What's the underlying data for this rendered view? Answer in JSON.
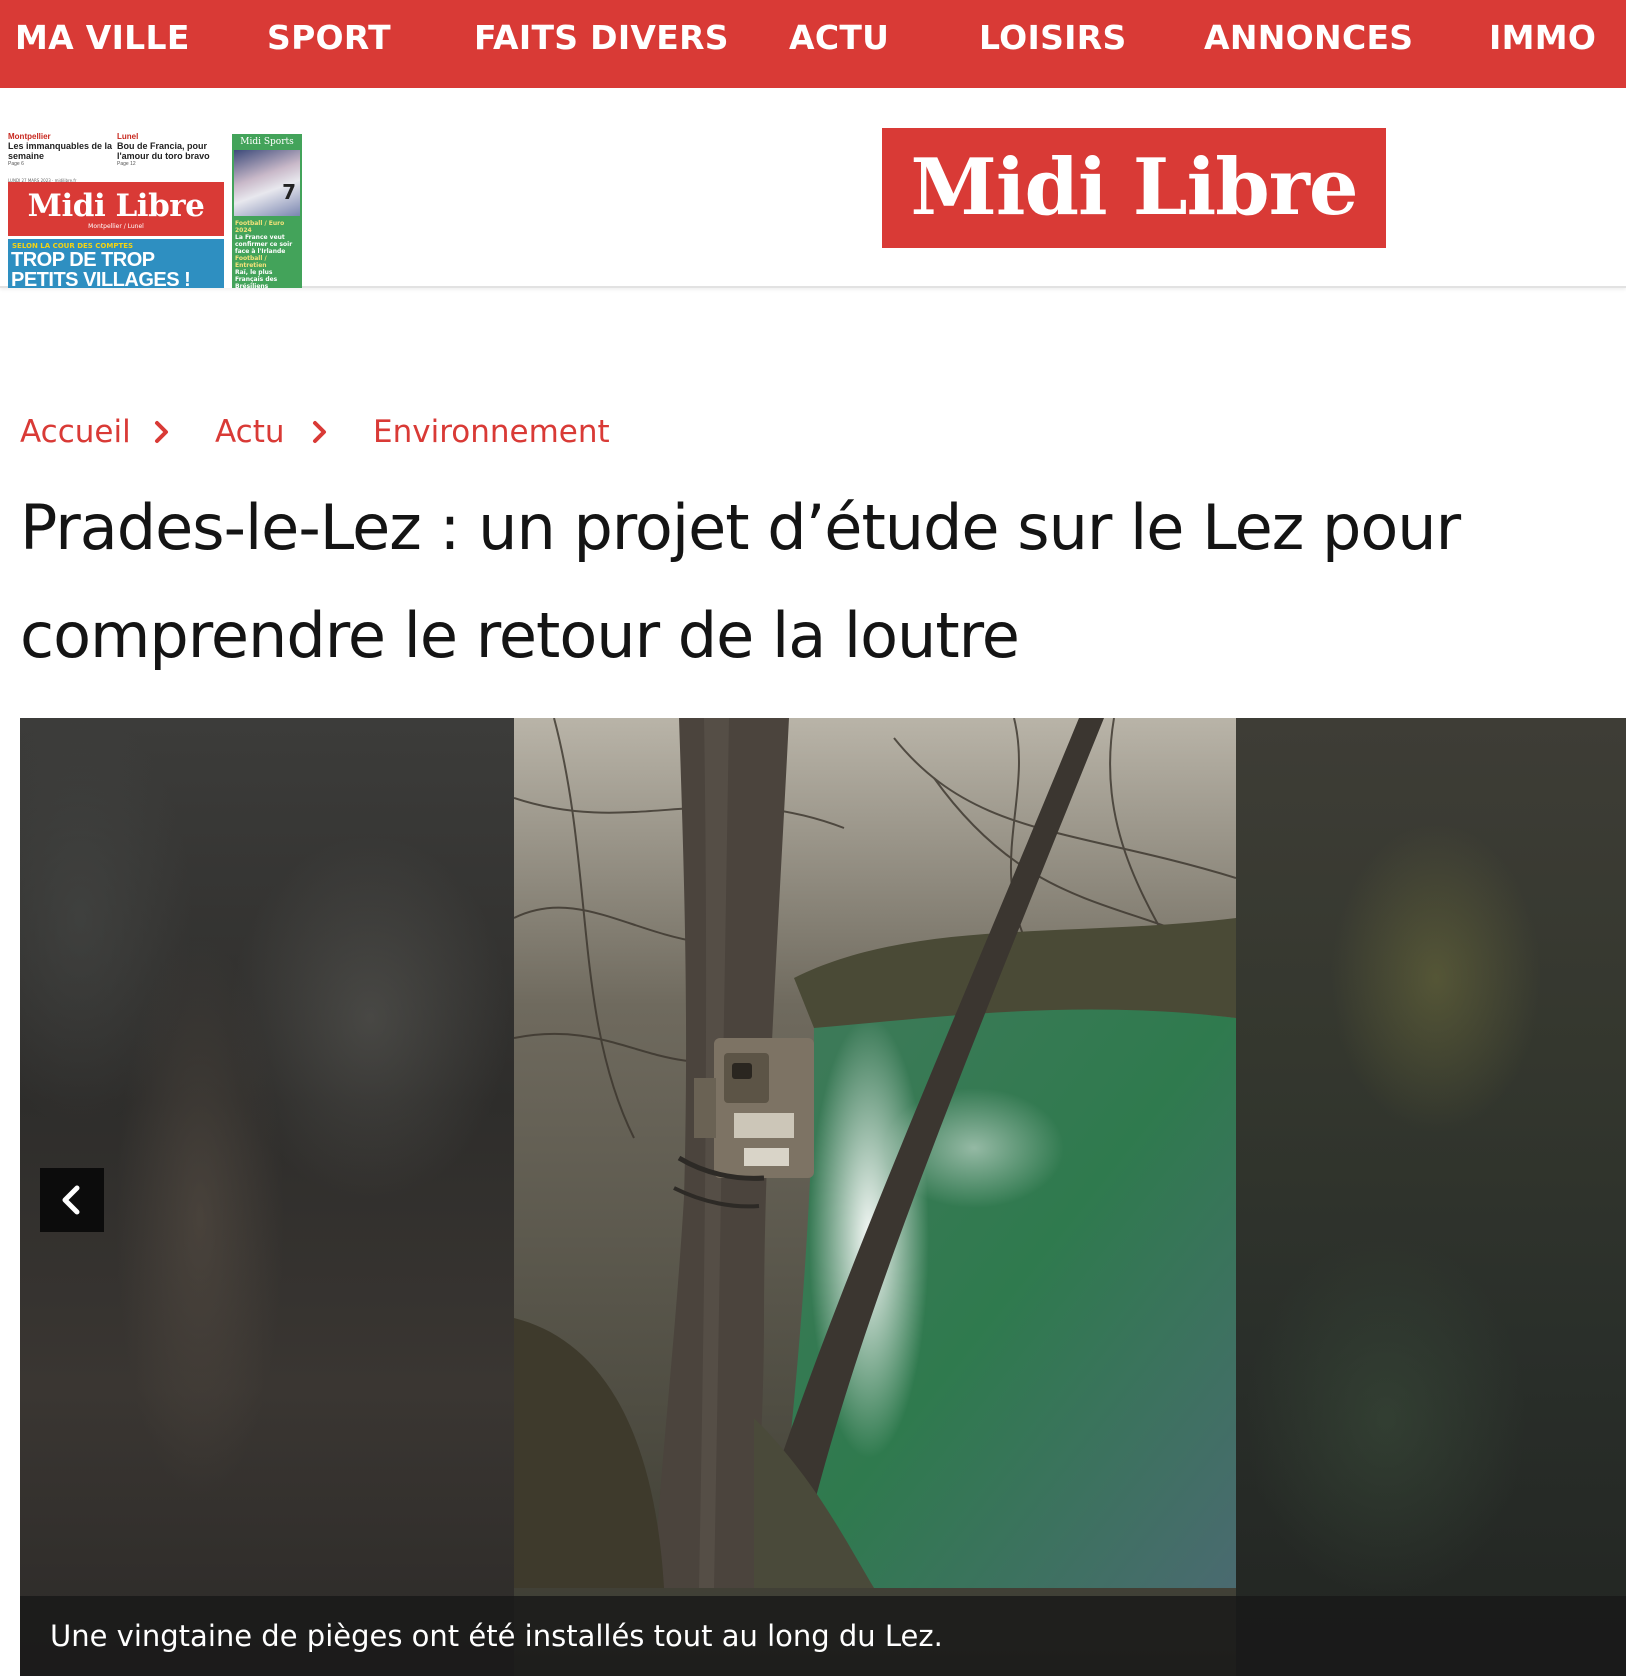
{
  "nav": {
    "items": [
      {
        "label": "MA VILLE"
      },
      {
        "label": "SPORT"
      },
      {
        "label": "FAITS DIVERS"
      },
      {
        "label": "ACTU"
      },
      {
        "label": "LOISIRS"
      },
      {
        "label": "ANNONCES"
      },
      {
        "label": "IMMO"
      }
    ]
  },
  "cover": {
    "teaser1_city": "Montpellier",
    "teaser1_text": "Les immanquables de la semaine",
    "teaser1_page": "Page 6",
    "teaser2_city": "Lunel",
    "teaser2_text": "Bou de Francia, pour l'amour du toro bravo",
    "teaser2_page": "Page 12",
    "date_line": "LUNDI 27 MARS 2023 · midilibre.fr",
    "masthead": "Midi Libre",
    "edition": "Montpellier / Lunel",
    "kicker": "SELON LA COUR DES COMPTES",
    "headline": "TROP DE TROP PETITS VILLAGES !",
    "sports_title": "Midi Sports",
    "sports_number": "7",
    "sports_kicker1": "Football / Euro 2024",
    "sports_text1": "La France veut confirmer ce soir face à l'Irlande",
    "sports_kicker2": "Football / Entretien",
    "sports_text2": "Raï, le plus Français des Brésiliens"
  },
  "logo": {
    "text": "Midi Libre",
    "color": "#d93a36"
  },
  "breadcrumb": {
    "items": [
      {
        "label": "Accueil"
      },
      {
        "label": "Actu"
      },
      {
        "label": "Environnement"
      }
    ],
    "separator_icon": "chevron-right-icon"
  },
  "article": {
    "title": "Prades-le-Lez : un projet d’étude sur le Lez pour comprendre le retour de la loutre"
  },
  "carousel": {
    "prev_icon": "chevron-left-icon",
    "caption": "Une vingtaine de pièges ont été installés tout au long du Lez."
  },
  "colors": {
    "brand_red": "#d93a36",
    "text": "#141414"
  }
}
